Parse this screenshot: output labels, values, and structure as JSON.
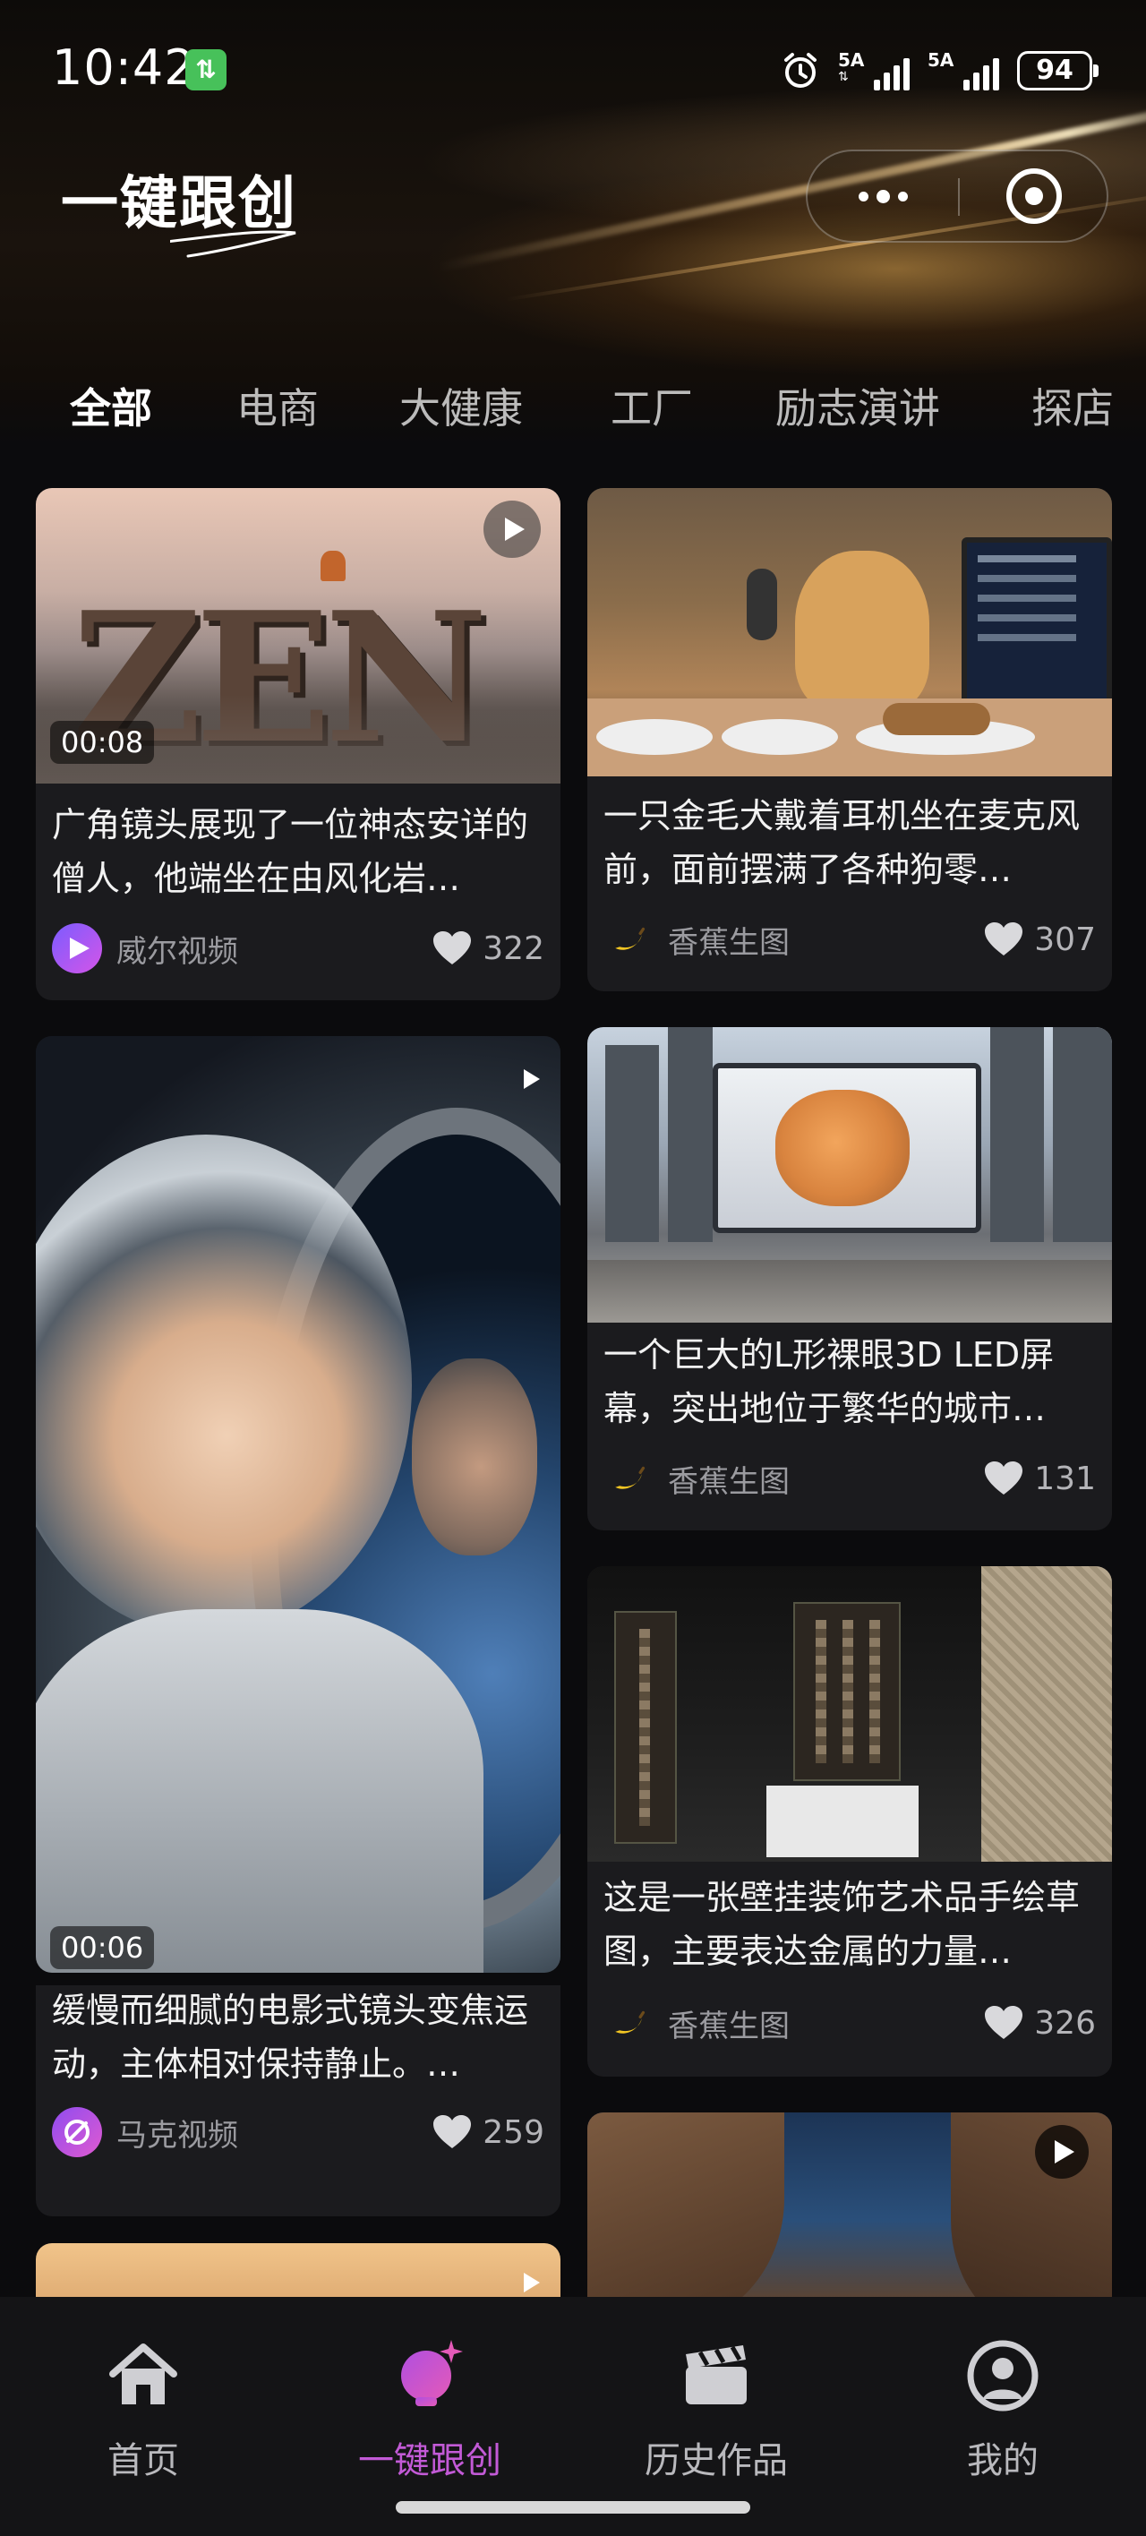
{
  "status": {
    "time": "10:42",
    "battery": "94",
    "net": "⇅",
    "sim1": "5A",
    "sim2": "5A"
  },
  "header": {
    "brand": "一键跟创",
    "tabs": [
      "全部",
      "电商",
      "大健康",
      "工厂",
      "励志演讲",
      "探店"
    ],
    "active_tab": 0
  },
  "colors": {
    "accent": "#c25ad6",
    "card_bg": "#1b1b1e",
    "page_bg": "#0b0b0d"
  },
  "cards": [
    {
      "title": "广角镜头展现了一位神态安详的僧人，他端坐在由风化岩…",
      "author": "威尔视频",
      "likes": "322",
      "duration": "00:08",
      "avatar_icon": "play-logo-icon"
    },
    {
      "title": "一只金毛犬戴着耳机坐在麦克风前，面前摆满了各种狗零…",
      "author": "香蕉生图",
      "likes": "307",
      "avatar_icon": "banana-icon"
    },
    {
      "title": "缓慢而细腻的电影式镜头变焦运动，主体相对保持静止。…",
      "author": "马克视频",
      "likes": "259",
      "duration": "00:06",
      "avatar_icon": "m-logo-icon"
    },
    {
      "title": "一个巨大的L形裸眼3D LED屏幕，突出地位于繁华的城市…",
      "author": "香蕉生图",
      "likes": "131",
      "avatar_icon": "banana-icon"
    },
    {
      "title": "这是一张壁挂装饰艺术品手绘草图，主要表达金属的力量…",
      "author": "香蕉生图",
      "likes": "326",
      "avatar_icon": "banana-icon"
    }
  ],
  "bottom_nav": [
    {
      "label": "首页",
      "icon": "home-icon"
    },
    {
      "label": "一键跟创",
      "icon": "magic-bulb-icon"
    },
    {
      "label": "历史作品",
      "icon": "clapperboard-icon"
    },
    {
      "label": "我的",
      "icon": "profile-icon"
    }
  ],
  "active_nav": 1
}
